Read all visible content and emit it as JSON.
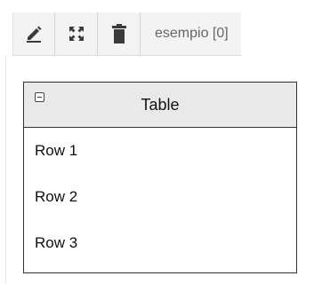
{
  "toolbar": {
    "buttons": [
      {
        "name": "edit",
        "icon": "pencil-icon"
      },
      {
        "name": "expand",
        "icon": "fullscreen-arrows-icon"
      },
      {
        "name": "delete",
        "icon": "trash-icon"
      }
    ],
    "label": "esempio [0]"
  },
  "table": {
    "title": "Table",
    "collapse_icon": "minus-box-icon",
    "rows": [
      "Row 1",
      "Row 2",
      "Row 3"
    ]
  },
  "colors": {
    "toolbar_bg": "#f3f3f3",
    "header_bg": "#e9e9e9",
    "border": "#333333",
    "icon": "#3a3a3a",
    "label_text": "#666666"
  }
}
